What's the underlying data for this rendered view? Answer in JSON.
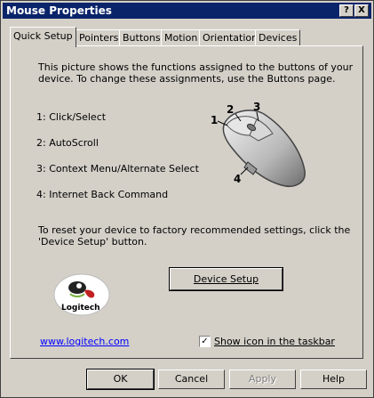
{
  "window": {
    "title": "Mouse Properties",
    "help_button": "?",
    "close_button": "X"
  },
  "tabs": [
    {
      "label": "Quick Setup",
      "active": true
    },
    {
      "label": "Pointers"
    },
    {
      "label": "Buttons"
    },
    {
      "label": "Motion"
    },
    {
      "label": "Orientation"
    },
    {
      "label": "Devices"
    }
  ],
  "quick_setup": {
    "intro_line1": "This picture shows the functions assigned to the buttons of your",
    "intro_line2": "device.  To change these assignments, use the Buttons page.",
    "assignments": [
      "1:  Click/Select",
      "2:  AutoScroll",
      "3:  Context Menu/Alternate Select",
      "4:  Internet Back Command"
    ],
    "callouts": [
      "1",
      "2",
      "3",
      "4"
    ],
    "reset_line1": "To reset your device to factory recommended settings, click the",
    "reset_line2": "'Device Setup' button.",
    "device_setup_button": "Device Setup",
    "logo_text": "Logitech",
    "website_link": "www.logitech.com",
    "show_icon_checkbox": {
      "label": "Show icon in the taskbar",
      "checked": true,
      "mark": "✓"
    }
  },
  "dialog_buttons": {
    "ok": "OK",
    "cancel": "Cancel",
    "apply": "Apply",
    "help": "Help"
  },
  "colors": {
    "title_bar": "#0a246a",
    "face": "#d4d0c8",
    "link": "#0000ff",
    "logo_green": "#7ab040"
  }
}
